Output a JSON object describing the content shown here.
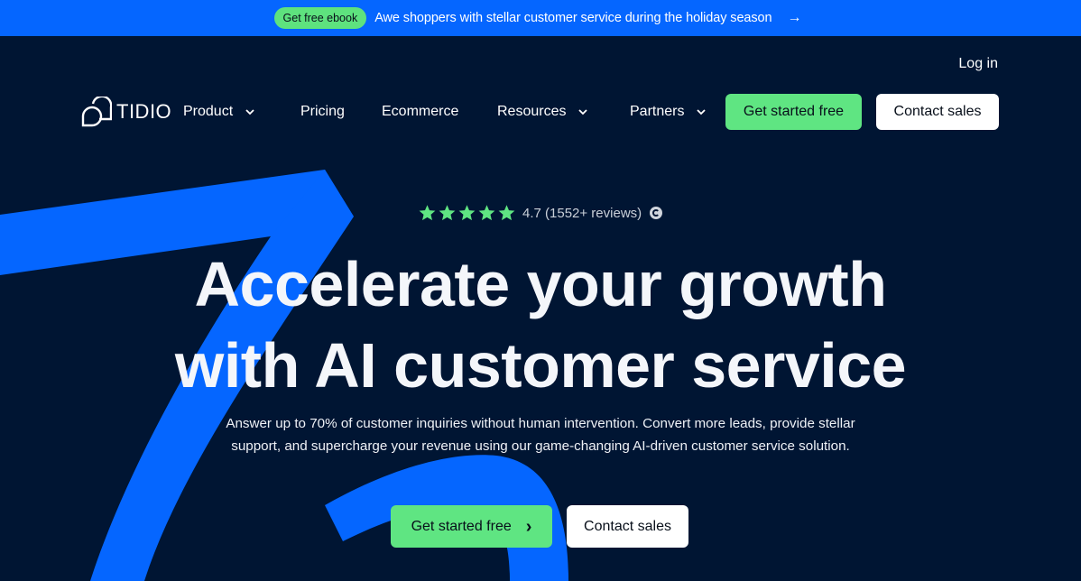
{
  "promo": {
    "badge_label": "Get free ebook",
    "text": "Awe shoppers with stellar customer service during the holiday season",
    "arrow_icon": "arrow-right-icon",
    "arrow_glyph": "→"
  },
  "header": {
    "login_label": "Log in",
    "logo_text": "TIDIO",
    "nav": [
      {
        "label": "Product",
        "has_dropdown": true
      },
      {
        "label": "Pricing",
        "has_dropdown": false
      },
      {
        "label": "Ecommerce",
        "has_dropdown": false
      },
      {
        "label": "Resources",
        "has_dropdown": true
      },
      {
        "label": "Partners",
        "has_dropdown": true
      }
    ],
    "primary_button": "Get started free",
    "secondary_button": "Contact sales"
  },
  "hero": {
    "rating": {
      "stars": 5,
      "score": "4.7",
      "text": "4.7 (1552+ reviews)",
      "source_icon": "g2-icon"
    },
    "headline_line1": "Accelerate your growth",
    "headline_line2": "with AI customer service",
    "subtext_line1": "Answer up to 70% of customer inquiries without human intervention. Convert more leads, provide stellar",
    "subtext_line2": "support, and supercharge your revenue using our game-changing AI-driven customer service solution.",
    "cta_primary": "Get started free",
    "cta_primary_icon": "chevron-right-icon",
    "cta_primary_glyph": "›",
    "cta_secondary": "Contact sales"
  },
  "colors": {
    "background": "#001533",
    "promo_bar": "#0566ff",
    "accent_blue": "#0566ff",
    "green": "#5fe582",
    "white": "#ffffff",
    "dark_text": "#080f1a"
  }
}
